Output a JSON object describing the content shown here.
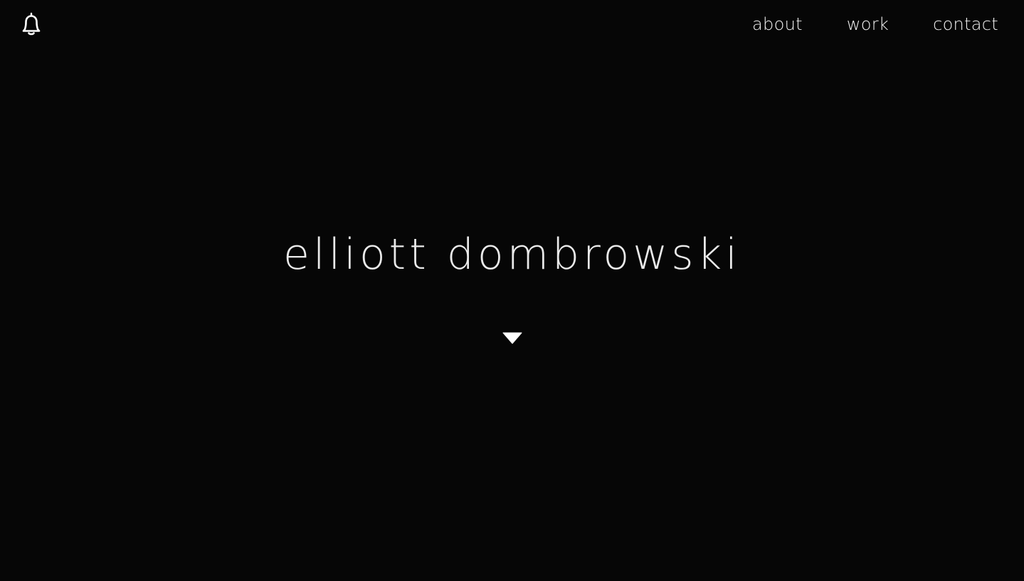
{
  "header": {
    "icon": "bell-icon",
    "nav": [
      {
        "label": "about"
      },
      {
        "label": "work"
      },
      {
        "label": "contact"
      }
    ]
  },
  "hero": {
    "title": "elliott dombrowski",
    "scroll_icon": "caret-down-icon"
  },
  "colors": {
    "background": "#060606",
    "text": "#ffffff"
  }
}
